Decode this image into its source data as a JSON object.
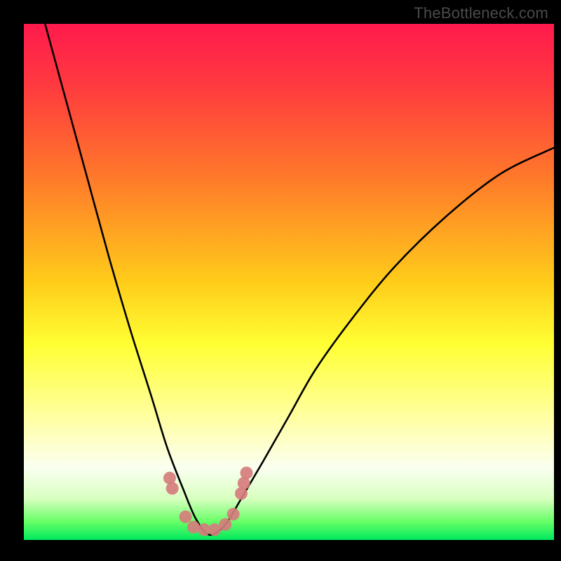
{
  "watermark": "TheBottleneck.com",
  "chart_data": {
    "type": "line",
    "title": "",
    "xlabel": "",
    "ylabel": "",
    "xlim": [
      0,
      100
    ],
    "ylim": [
      0,
      100
    ],
    "gradient_stops": [
      {
        "offset": 0.0,
        "color": "#ff1a4d"
      },
      {
        "offset": 0.12,
        "color": "#ff3a3f"
      },
      {
        "offset": 0.3,
        "color": "#ff7a2a"
      },
      {
        "offset": 0.5,
        "color": "#ffcc1a"
      },
      {
        "offset": 0.62,
        "color": "#ffff33"
      },
      {
        "offset": 0.78,
        "color": "#ffffb0"
      },
      {
        "offset": 0.86,
        "color": "#fafff0"
      },
      {
        "offset": 0.92,
        "color": "#d8ffc0"
      },
      {
        "offset": 0.965,
        "color": "#66ff66"
      },
      {
        "offset": 1.0,
        "color": "#00e85e"
      }
    ],
    "series": [
      {
        "name": "bottleneck-curve",
        "x": [
          4,
          8,
          12,
          16,
          20,
          24,
          27,
          30,
          32.5,
          35,
          38,
          41,
          45,
          50,
          55,
          62,
          70,
          80,
          90,
          100
        ],
        "values": [
          100,
          85,
          70,
          55,
          41,
          28,
          18,
          10,
          4,
          1,
          3,
          8,
          15,
          24,
          33,
          43,
          53,
          63,
          71,
          76
        ]
      }
    ],
    "markers": {
      "name": "confidence-band",
      "color": "#d67d7d",
      "points": [
        {
          "x": 27.5,
          "y": 12
        },
        {
          "x": 28,
          "y": 10
        },
        {
          "x": 30.5,
          "y": 4.5
        },
        {
          "x": 32,
          "y": 2.5
        },
        {
          "x": 34,
          "y": 2
        },
        {
          "x": 36,
          "y": 2
        },
        {
          "x": 38,
          "y": 3
        },
        {
          "x": 39.5,
          "y": 5
        },
        {
          "x": 41,
          "y": 9
        },
        {
          "x": 41.5,
          "y": 11
        },
        {
          "x": 42,
          "y": 13
        }
      ]
    }
  }
}
